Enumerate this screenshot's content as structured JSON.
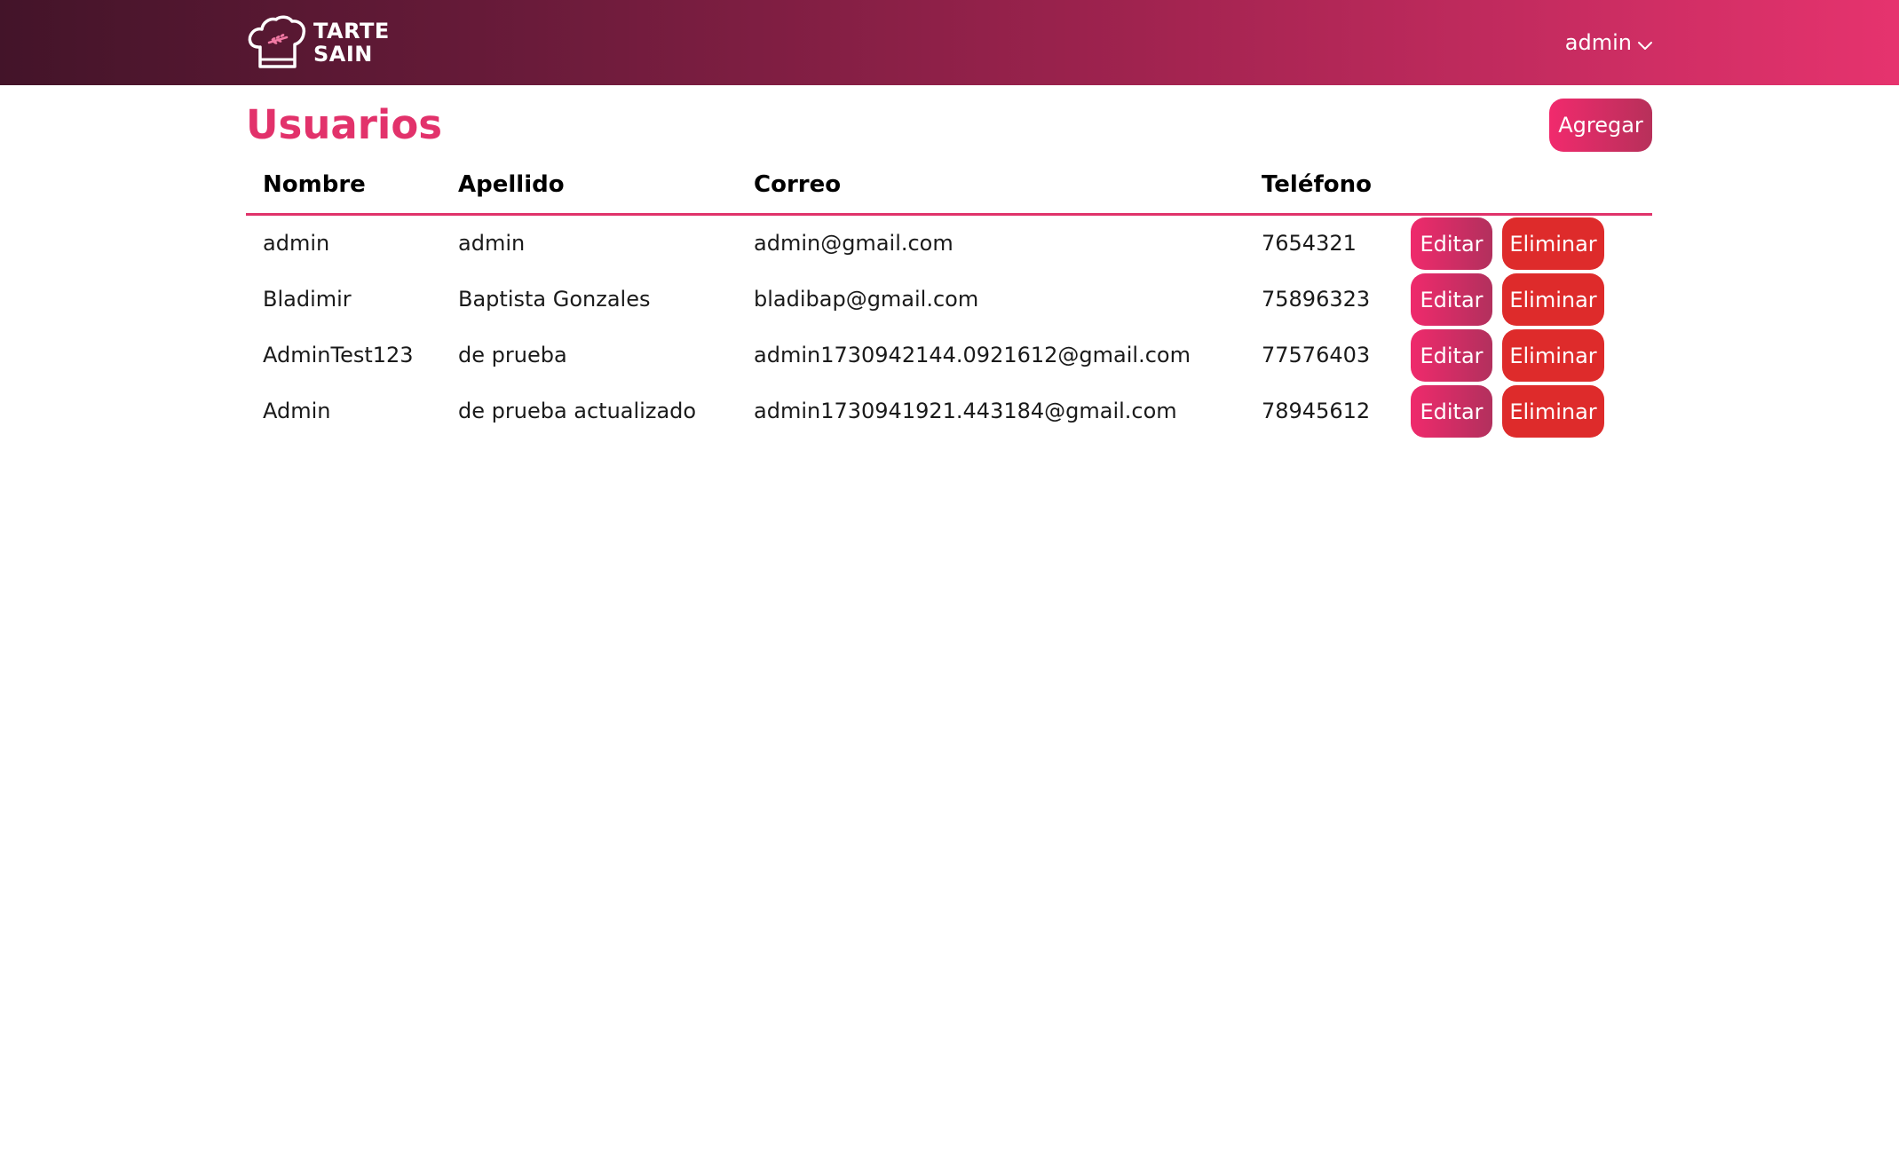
{
  "header": {
    "brand": {
      "line1": "TARTE",
      "line2": "SAIN"
    },
    "user_menu": {
      "label": "admin"
    }
  },
  "page": {
    "title": "Usuarios",
    "add_label": "Agregar"
  },
  "table": {
    "columns": {
      "nombre": "Nombre",
      "apellido": "Apellido",
      "correo": "Correo",
      "telefono": "Teléfono"
    },
    "rows": [
      {
        "nombre": "admin",
        "apellido": "admin",
        "correo": "admin@gmail.com",
        "telefono": "7654321"
      },
      {
        "nombre": "Bladimir",
        "apellido": "Baptista Gonzales",
        "correo": "bladibap@gmail.com",
        "telefono": "75896323"
      },
      {
        "nombre": "AdminTest123",
        "apellido": "de prueba",
        "correo": "admin1730942144.0921612@gmail.com",
        "telefono": "77576403"
      },
      {
        "nombre": "Admin",
        "apellido": "de prueba actualizado",
        "correo": "admin1730941921.443184@gmail.com",
        "telefono": "78945612"
      }
    ],
    "actions": {
      "edit_label": "Editar",
      "delete_label": "Eliminar"
    }
  },
  "icons": {
    "logo": "chef-hat-icon",
    "user_menu_caret": "chevron-down-icon"
  },
  "colors": {
    "header_gradient_start": "#431429",
    "header_gradient_end": "#e6336e",
    "accent": "#e2326b",
    "delete": "#de2b2b"
  }
}
